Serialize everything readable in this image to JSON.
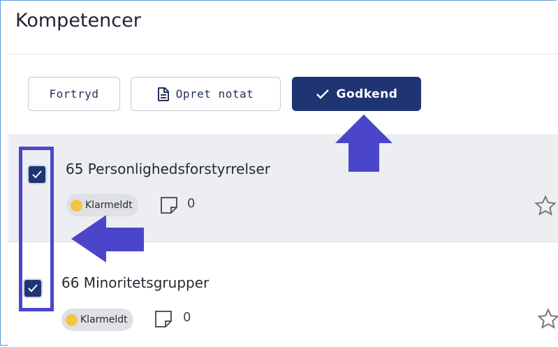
{
  "header": {
    "title": "Kompetencer"
  },
  "toolbar": {
    "cancel_label": "Fortryd",
    "note_label": "Opret notat",
    "approve_label": "Godkend"
  },
  "items": [
    {
      "title": "65 Personlighedsforstyrrelser",
      "status": "Klarmeldt",
      "notes": "0",
      "checked": true
    },
    {
      "title": "66 Minoritetsgrupper",
      "status": "Klarmeldt",
      "notes": "0",
      "checked": true
    }
  ],
  "colors": {
    "primary": "#1f3473",
    "annotation": "#4b46c9",
    "status_dot": "#f6c342",
    "selected_row": "#eceef2"
  },
  "icons": [
    "document-icon",
    "check-icon",
    "note-icon",
    "star-icon",
    "checkbox-check-icon"
  ]
}
